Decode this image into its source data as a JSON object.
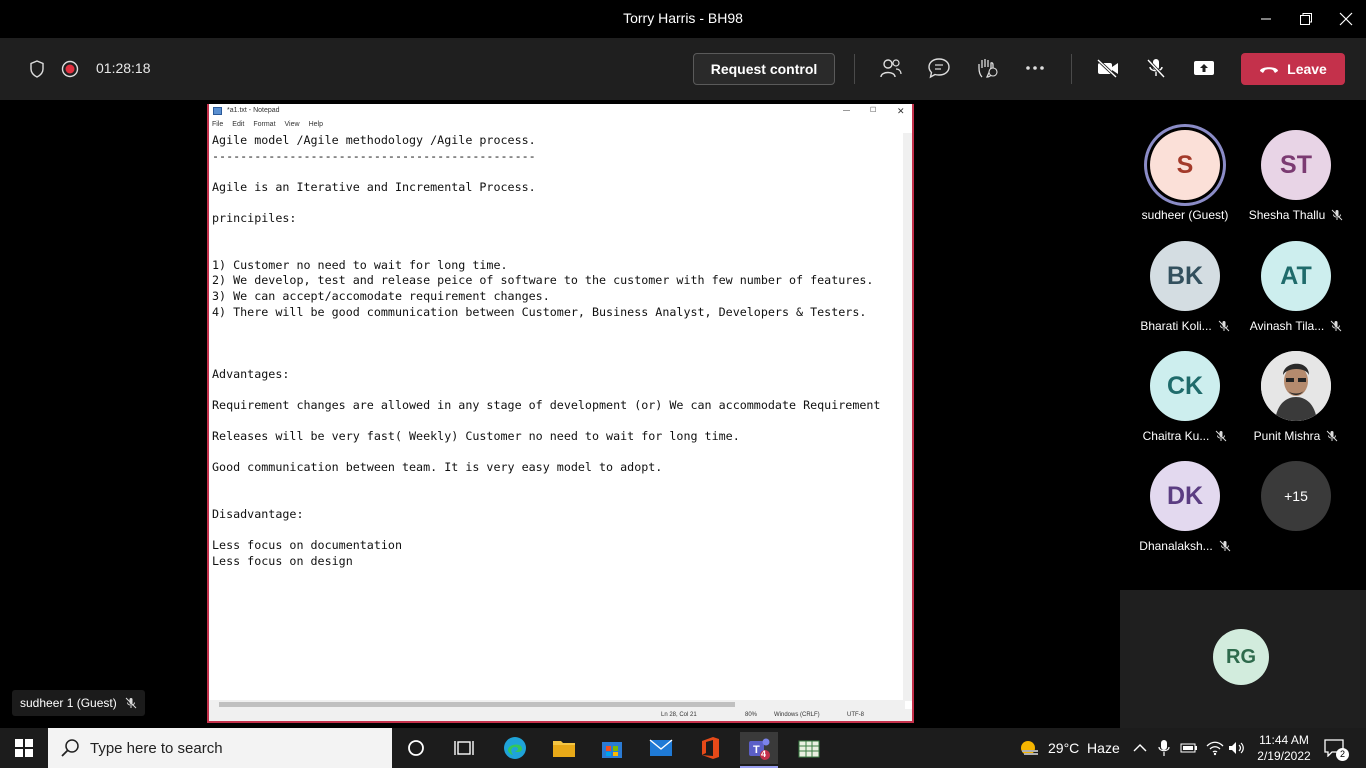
{
  "window": {
    "title": "Torry Harris - BH98"
  },
  "meeting": {
    "timer": "01:28:18",
    "request_control_label": "Request control",
    "leave_label": "Leave"
  },
  "notepad": {
    "title": "*a1.txt - Notepad",
    "menu": [
      "File",
      "Edit",
      "Format",
      "View",
      "Help"
    ],
    "content": "Agile model /Agile methodology /Agile process.\n----------------------------------------------\n\nAgile is an Iterative and Incremental Process.\n\nprincipiles:\n\n\n1) Customer no need to wait for long time.\n2) We develop, test and release peice of software to the customer with few number of features.\n3) We can accept/accomodate requirement changes.\n4) There will be good communication between Customer, Business Analyst, Developers & Testers.\n\n\n\nAdvantages:\n\nRequirement changes are allowed in any stage of development (or) We can accommodate Requirement \n\nReleases will be very fast( Weekly) Customer no need to wait for long time.\n\nGood communication between team. It is very easy model to adopt.\n\n\nDisadvantage:\n\nLess focus on documentation\nLess focus on design",
    "status": {
      "position": "Ln 28, Col 21",
      "zoom": "80%",
      "line_ending": "Windows (CRLF)",
      "encoding": "UTF-8"
    }
  },
  "participants": [
    {
      "initials": "S",
      "name": "sudheer (Guest)",
      "muted": false,
      "bg": "#fbe0d8",
      "fg": "#a33a2a",
      "speaking": true
    },
    {
      "initials": "ST",
      "name": "Shesha Thallu",
      "muted": true,
      "bg": "#e8d4e6",
      "fg": "#7b3b72"
    },
    {
      "initials": "BK",
      "name": "Bharati Koli...",
      "muted": true,
      "bg": "#d4dde2",
      "fg": "#33505e"
    },
    {
      "initials": "AT",
      "name": "Avinash Tila...",
      "muted": true,
      "bg": "#cdeeee",
      "fg": "#1f6b6b"
    },
    {
      "initials": "CK",
      "name": "Chaitra Ku...",
      "muted": true,
      "bg": "#cdeeee",
      "fg": "#1f6b6b"
    },
    {
      "initials": "",
      "name": "Punit Mishra",
      "muted": true,
      "photo": true
    },
    {
      "initials": "DK",
      "name": "Dhanalaksh...",
      "muted": true,
      "bg": "#e3d9ef",
      "fg": "#5b3d82"
    },
    {
      "initials": "+15",
      "name": "",
      "muted": false,
      "bg": "#3a3a3a",
      "fg": "#ffffff"
    }
  ],
  "rg_tile": {
    "initials": "RG"
  },
  "self_view": {
    "name": "sudheer 1 (Guest)"
  },
  "taskbar": {
    "search_placeholder": "Type here to search",
    "weather": "29°C  Haze",
    "time": "11:44 AM",
    "date": "2/19/2022",
    "notification_count": "2",
    "teams_badge": "4"
  },
  "colors": {
    "leave": "#c4314b",
    "notepad_border": "#c4314b",
    "speaking_ring": "#8b8cc7"
  }
}
